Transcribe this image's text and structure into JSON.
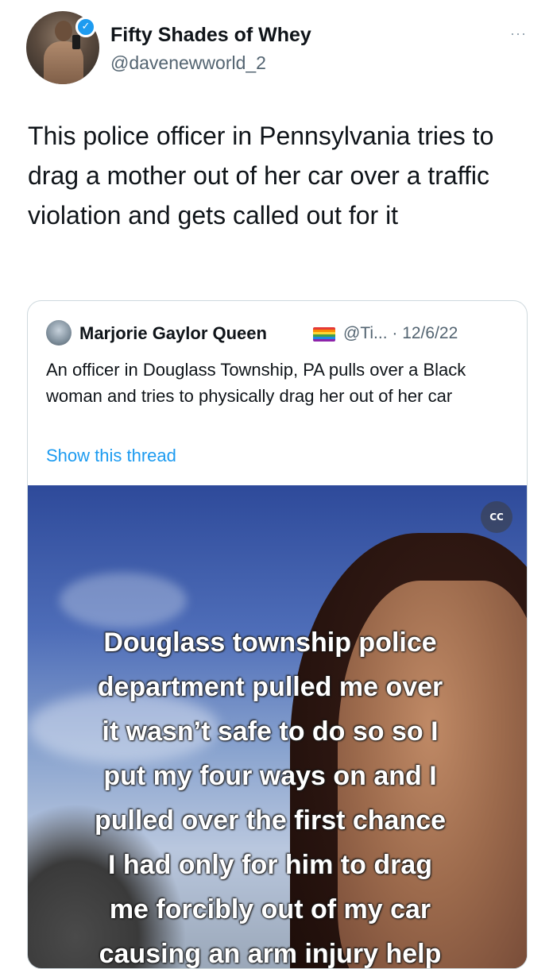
{
  "author": {
    "display_name": "Fifty Shades of Whey",
    "handle": "@davenewworld_2",
    "verified_icon": "verified-badge-icon",
    "more_glyph": "···"
  },
  "tweet": {
    "text": "This police officer in Pennsylvania tries to drag a mother out of her car over a traffic violation and gets called out for it"
  },
  "quoted_tweet": {
    "display_name": "Marjorie Gaylor Queen",
    "flag_icon": "rainbow-flag-icon",
    "meta": "@Ti... · 12/6/22",
    "text": "An officer in Douglass Township, PA pulls over a Black woman and tries to physically drag her out of her car",
    "show_thread": "Show this thread"
  },
  "video": {
    "cc_label": "CC",
    "caption": "Douglass township police\ndepartment pulled me over\nit wasn’t safe to do so so I\nput my four ways on and I\npulled over the first chance\nI had only for him to drag\nme forcibly out of my car\ncausing an arm injury help"
  },
  "colors": {
    "link": "#1d9bf0",
    "secondary_text": "#536471",
    "border": "#cfd9de"
  }
}
